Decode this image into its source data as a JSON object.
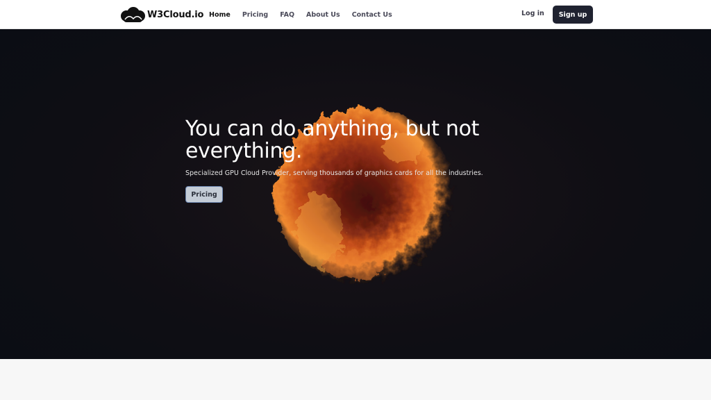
{
  "brand": {
    "name": "W3Cloud.io",
    "logo_icon": "cloud-logo-icon"
  },
  "nav": {
    "links": [
      {
        "label": "Home",
        "active": true
      },
      {
        "label": "Pricing",
        "active": false
      },
      {
        "label": "FAQ",
        "active": false
      },
      {
        "label": "About Us",
        "active": false
      },
      {
        "label": "Contact Us",
        "active": false
      }
    ],
    "login_label": "Log in",
    "signup_label": "Sign up"
  },
  "hero": {
    "title": "You can do anything, but not everything.",
    "subtitle": "Specialized GPU Cloud Provider, serving thousands of graphics cards for all the industries.",
    "cta_label": "Pricing"
  },
  "colors": {
    "navbar_bg": "#ffffff",
    "hero_bg": "#0f0e14",
    "signup_bg": "#1f2230",
    "cta_bg": "#c4ccd6",
    "fire_orange": "#e8742a"
  }
}
